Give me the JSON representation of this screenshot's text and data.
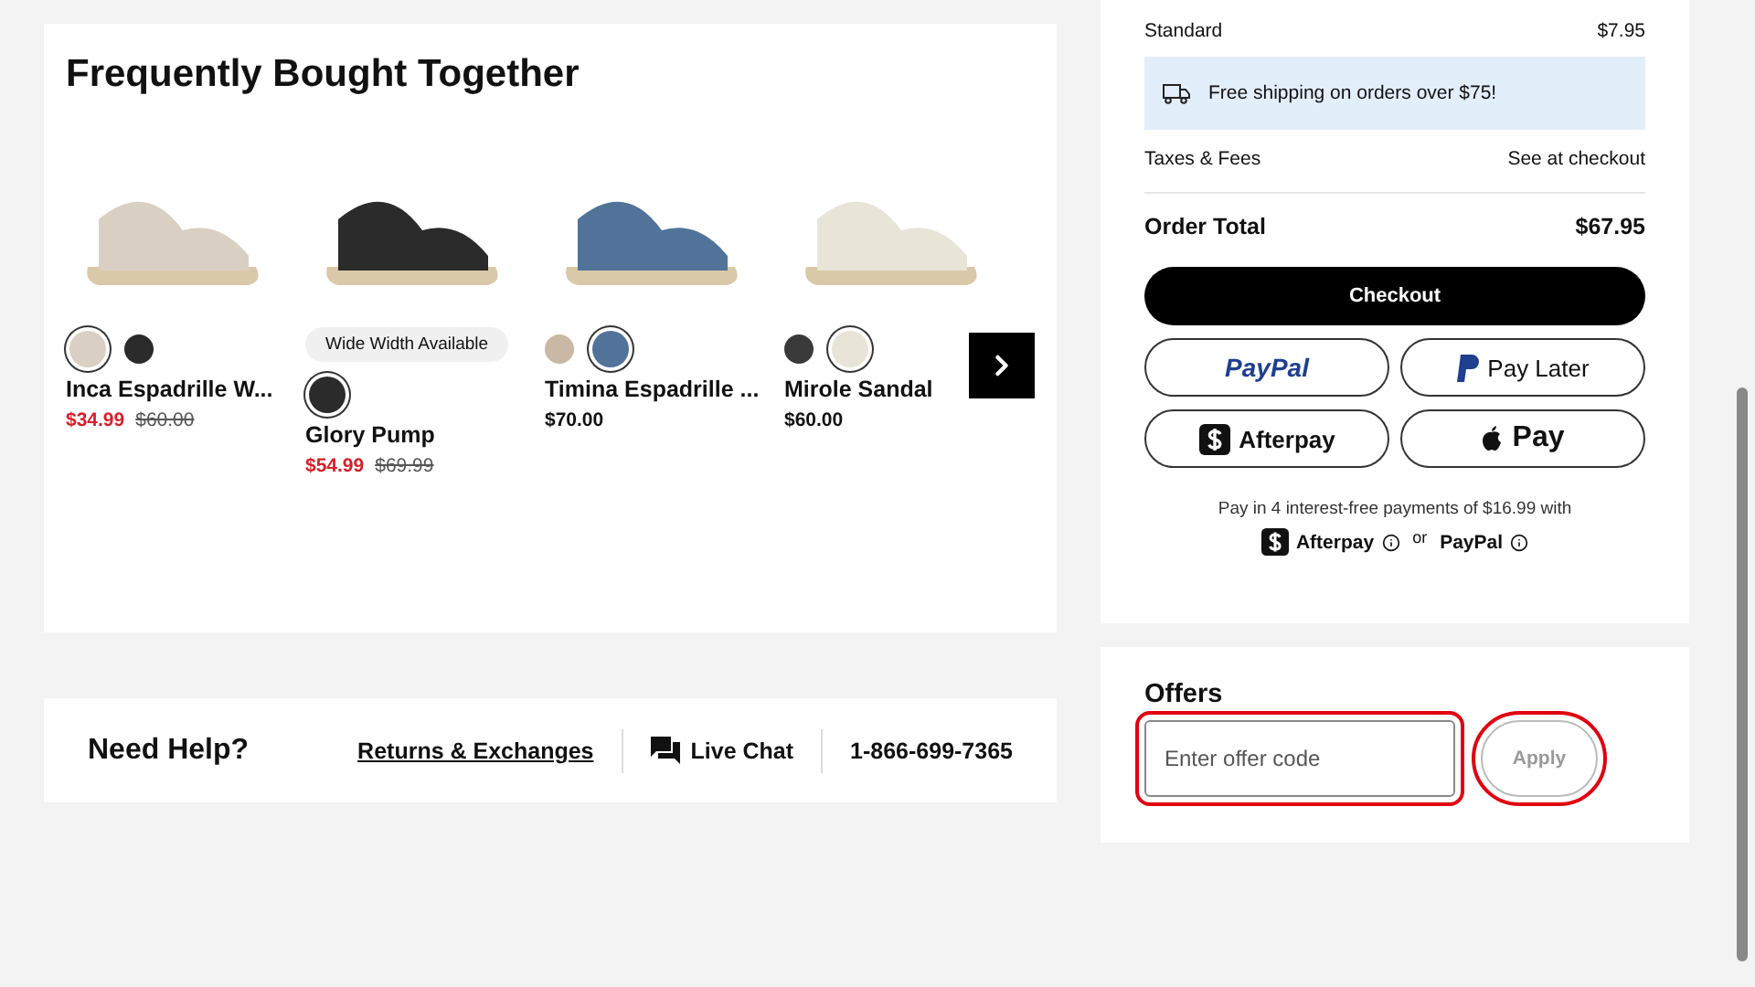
{
  "recommendations": {
    "title": "Frequently Bought Together",
    "products": [
      {
        "name": "Inca Espadrille W...",
        "price": "$34.99",
        "original_price": "$60.00",
        "on_sale": true,
        "swatches": [
          {
            "color": "#d9d0c3",
            "selected": true
          },
          {
            "color": "#2b2b2b",
            "selected": false
          }
        ]
      },
      {
        "name": "Glory Pump",
        "badge": "Wide Width Available",
        "price": "$54.99",
        "original_price": "$69.99",
        "on_sale": true,
        "swatches": [
          {
            "color": "#2b2b2b",
            "selected": true
          }
        ]
      },
      {
        "name": "Timina Espadrille ...",
        "price": "$70.00",
        "on_sale": false,
        "swatches": [
          {
            "color": "#c9b8a3",
            "selected": false
          },
          {
            "color": "#51739a",
            "selected": true
          }
        ]
      },
      {
        "name": "Mirole Sandal",
        "price": "$60.00",
        "on_sale": false,
        "swatches": [
          {
            "color": "#3a3a3a",
            "selected": false
          },
          {
            "color": "#e8e4d8",
            "selected": true
          }
        ]
      }
    ]
  },
  "help": {
    "title": "Need Help?",
    "returns_link": "Returns & Exchanges",
    "chat": "Live Chat",
    "phone": "1-866-699-7365"
  },
  "summary": {
    "rows": [
      {
        "label": "Standard",
        "value": "$7.95"
      }
    ],
    "shipping_banner": "Free shipping on orders over $75!",
    "taxes": {
      "label": "Taxes & Fees",
      "value": "See at checkout"
    },
    "total": {
      "label": "Order Total",
      "value": "$67.95"
    },
    "checkout": "Checkout",
    "payment_buttons": [
      {
        "kind": "paypal",
        "label": "PayPal"
      },
      {
        "kind": "paylater",
        "label": "Pay Later"
      },
      {
        "kind": "afterpay",
        "label": "Afterpay"
      },
      {
        "kind": "applepay",
        "label": "Pay"
      }
    ],
    "installments": {
      "text": "Pay in 4 interest-free payments of $16.99 with",
      "afterpay": "Afterpay",
      "or": "or",
      "paypal": "PayPal"
    }
  },
  "offers": {
    "title": "Offers",
    "placeholder": "Enter offer code",
    "apply": "Apply",
    "disabled": true,
    "highlighted": true
  }
}
